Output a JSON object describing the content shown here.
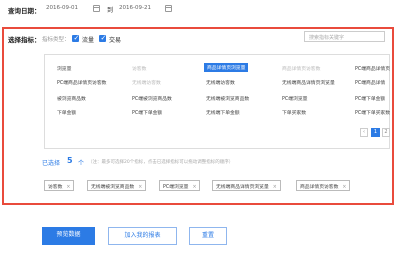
{
  "query": {
    "label": "查询日期：",
    "start_date": "2016-09-01",
    "to_label": "到",
    "end_date": "2016-09-21"
  },
  "selector": {
    "label": "选择指标：",
    "type_label": "指标类型：",
    "options": [
      {
        "label": "流量",
        "checked": true
      },
      {
        "label": "交易",
        "checked": true
      }
    ],
    "search_placeholder": "搜索指标关键字"
  },
  "metrics_grid": [
    [
      "浏览量",
      "访客数",
      "商品详情页浏览量",
      "商品详情页访客数",
      "PC端商品详情页"
    ],
    [
      "PC端商品详情页访客数",
      "无线端访客数",
      "无线端访客数",
      "无线端商品详情页浏览量",
      "PC端商品详情"
    ],
    [
      "被浏览商品数",
      "PC端被浏览商品数",
      "无线端被浏览商品数",
      "PC端浏览量",
      "PC端下单金额"
    ],
    [
      "下单金额",
      "PC端下单金额",
      "无线端下单金额",
      "下单买家数",
      "PC端下单买家数"
    ]
  ],
  "metrics_state": {
    "selected": [
      "商品详情页浏览量"
    ],
    "dimmed": [
      "访客数",
      "商品详情页访客数",
      "无线端访客数"
    ]
  },
  "pager": {
    "prev": "‹",
    "current": "1",
    "next": "2"
  },
  "chosen": {
    "label": "已选择",
    "count": "5",
    "unit": "个",
    "hint": "（注：最多可选择20个指标，点击已选择指标可以拖动调整指标的顺序）",
    "tags": [
      "访客数",
      "无线端被浏览商品数",
      "PC端浏览量",
      "无线端商品详情页浏览量",
      "商品详情页访客数"
    ]
  },
  "buttons": {
    "preview": "预览数据",
    "add_report": "加入我的报表",
    "reset": "重置"
  },
  "colors": {
    "accent": "#2c7be5",
    "highlight_border": "#e94b3c"
  }
}
